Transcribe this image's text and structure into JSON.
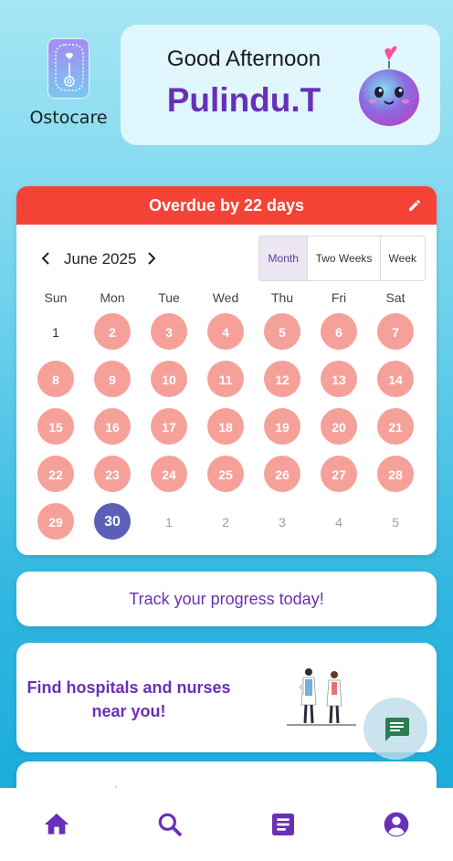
{
  "app": {
    "name": "Ostocare"
  },
  "greeting": {
    "line": "Good Afternoon",
    "name": "Pulindu.T"
  },
  "calendar": {
    "banner": "Overdue by 22 days",
    "month_label": "June 2025",
    "views": [
      "Month",
      "Two Weeks",
      "Week"
    ],
    "active_view": "Month",
    "weekdays": [
      "Sun",
      "Mon",
      "Tue",
      "Wed",
      "Thu",
      "Fri",
      "Sat"
    ],
    "days": [
      {
        "n": "1",
        "state": "plain"
      },
      {
        "n": "2",
        "state": "period"
      },
      {
        "n": "3",
        "state": "period"
      },
      {
        "n": "4",
        "state": "period"
      },
      {
        "n": "5",
        "state": "period"
      },
      {
        "n": "6",
        "state": "period"
      },
      {
        "n": "7",
        "state": "period"
      },
      {
        "n": "8",
        "state": "period"
      },
      {
        "n": "9",
        "state": "period"
      },
      {
        "n": "10",
        "state": "period"
      },
      {
        "n": "11",
        "state": "period"
      },
      {
        "n": "12",
        "state": "period"
      },
      {
        "n": "13",
        "state": "period"
      },
      {
        "n": "14",
        "state": "period"
      },
      {
        "n": "15",
        "state": "period"
      },
      {
        "n": "16",
        "state": "period"
      },
      {
        "n": "17",
        "state": "period"
      },
      {
        "n": "18",
        "state": "period"
      },
      {
        "n": "19",
        "state": "period"
      },
      {
        "n": "20",
        "state": "period"
      },
      {
        "n": "21",
        "state": "period"
      },
      {
        "n": "22",
        "state": "period"
      },
      {
        "n": "23",
        "state": "period"
      },
      {
        "n": "24",
        "state": "period"
      },
      {
        "n": "25",
        "state": "period"
      },
      {
        "n": "26",
        "state": "period"
      },
      {
        "n": "27",
        "state": "period"
      },
      {
        "n": "28",
        "state": "period"
      },
      {
        "n": "29",
        "state": "period"
      },
      {
        "n": "30",
        "state": "today"
      },
      {
        "n": "1",
        "state": "muted"
      },
      {
        "n": "2",
        "state": "muted"
      },
      {
        "n": "3",
        "state": "muted"
      },
      {
        "n": "4",
        "state": "muted"
      },
      {
        "n": "5",
        "state": "muted"
      }
    ]
  },
  "cards": {
    "track": "Track your progress today!",
    "hospitals_line1": "Find hospitals and nurses",
    "hospitals_line2": "near you!"
  },
  "colors": {
    "accent": "#6a2fb6",
    "banner": "#f44336",
    "period": "#f6a09a",
    "today": "#5b5fb8"
  },
  "icons": {
    "fab": "chat-icon",
    "nav": [
      "home-icon",
      "search-icon",
      "article-icon",
      "account-icon"
    ]
  }
}
